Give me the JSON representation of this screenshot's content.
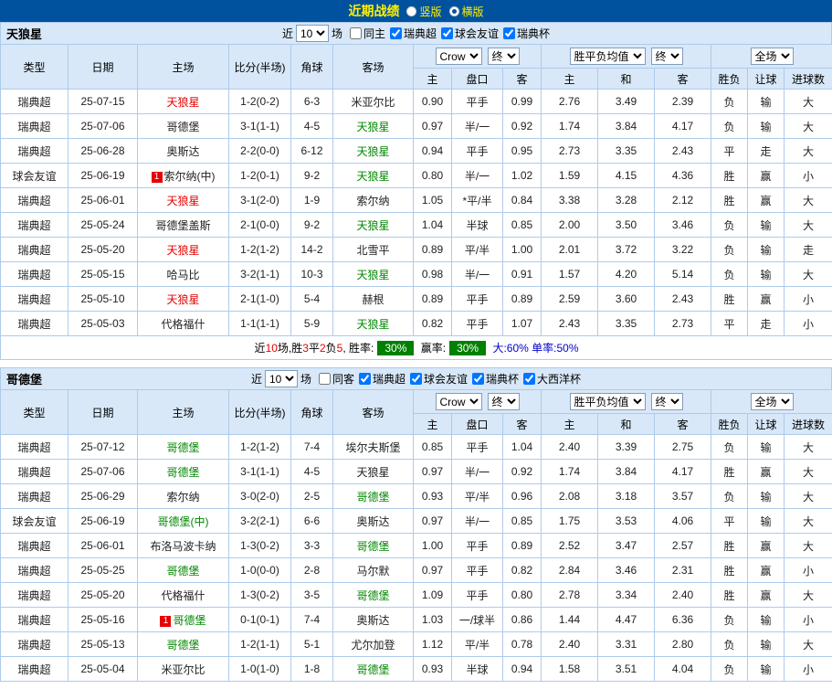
{
  "topbar": {
    "title": "近期战绩",
    "options": [
      {
        "label": "竖版",
        "selected": false
      },
      {
        "label": "横版",
        "selected": true
      }
    ]
  },
  "colors": {
    "accent": "#00529E",
    "friendly": "#00A098",
    "win": "#E60000",
    "draw": "#0000CC",
    "lose": "#008800",
    "rate_badge_bg": "#008000",
    "header_bg": "#D8E8F8"
  },
  "sections": [
    {
      "team": "天狼星",
      "filter": {
        "near": "近",
        "count": "10",
        "unit": "场",
        "checkboxes": [
          {
            "label": "同主",
            "checked": false
          },
          {
            "label": "瑞典超",
            "checked": true
          },
          {
            "label": "球会友谊",
            "checked": true
          },
          {
            "label": "瑞典杯",
            "checked": true
          }
        ]
      },
      "header": {
        "type": "类型",
        "date": "日期",
        "home": "主场",
        "score": "比分(半场)",
        "corner": "角球",
        "away": "客场",
        "odds_company": "Crow",
        "odds_stage": "终",
        "avg_label": "胜平负均值",
        "avg_stage": "终",
        "scope_label": "全场",
        "sub": [
          "主",
          "盘口",
          "客",
          "主",
          "和",
          "客",
          "胜负",
          "让球",
          "进球数"
        ]
      },
      "rows": [
        {
          "league": "瑞典超",
          "league_type": "league",
          "date": "25-07-15",
          "home": "天狼星",
          "home_color": "red",
          "home_badge": "",
          "score": "1-2(0-2)",
          "corner": "6-3",
          "away": "米亚尔比",
          "away_color": "black",
          "odds_home": "0.90",
          "handicap": "平手",
          "odds_away": "0.99",
          "avg_home": "2.76",
          "avg_draw": "3.49",
          "avg_away": "2.39",
          "result": "负",
          "result_color": "green",
          "cover": "输",
          "cover_color": "green",
          "goals": "大",
          "goals_color": "red"
        },
        {
          "league": "瑞典超",
          "league_type": "league",
          "date": "25-07-06",
          "home": "哥德堡",
          "home_color": "black",
          "home_badge": "",
          "score": "3-1(1-1)",
          "corner": "4-5",
          "away": "天狼星",
          "away_color": "green",
          "odds_home": "0.97",
          "handicap": "半/一",
          "odds_away": "0.92",
          "avg_home": "1.74",
          "avg_draw": "3.84",
          "avg_away": "4.17",
          "result": "负",
          "result_color": "green",
          "cover": "输",
          "cover_color": "green",
          "goals": "大",
          "goals_color": "red"
        },
        {
          "league": "瑞典超",
          "league_type": "league",
          "date": "25-06-28",
          "home": "奥斯达",
          "home_color": "black",
          "home_badge": "",
          "score": "2-2(0-0)",
          "corner": "6-12",
          "away": "天狼星",
          "away_color": "green",
          "odds_home": "0.94",
          "handicap": "平手",
          "odds_away": "0.95",
          "avg_home": "2.73",
          "avg_draw": "3.35",
          "avg_away": "2.43",
          "result": "平",
          "result_color": "blue",
          "cover": "走",
          "cover_color": "blue",
          "goals": "大",
          "goals_color": "red"
        },
        {
          "league": "球会友谊",
          "league_type": "friendly",
          "date": "25-06-19",
          "home": "索尔纳(中)",
          "home_color": "black",
          "home_badge": "1",
          "score": "1-2(0-1)",
          "corner": "9-2",
          "away": "天狼星",
          "away_color": "green",
          "odds_home": "0.80",
          "handicap": "半/一",
          "odds_away": "1.02",
          "avg_home": "1.59",
          "avg_draw": "4.15",
          "avg_away": "4.36",
          "result": "胜",
          "result_color": "red",
          "cover": "赢",
          "cover_color": "red",
          "goals": "小",
          "goals_color": "green"
        },
        {
          "league": "瑞典超",
          "league_type": "league",
          "date": "25-06-01",
          "home": "天狼星",
          "home_color": "red",
          "home_badge": "",
          "score": "3-1(2-0)",
          "corner": "1-9",
          "away": "索尔纳",
          "away_color": "black",
          "odds_home": "1.05",
          "handicap": "*平/半",
          "odds_away": "0.84",
          "avg_home": "3.38",
          "avg_draw": "3.28",
          "avg_away": "2.12",
          "result": "胜",
          "result_color": "red",
          "cover": "赢",
          "cover_color": "red",
          "goals": "大",
          "goals_color": "red"
        },
        {
          "league": "瑞典超",
          "league_type": "league",
          "date": "25-05-24",
          "home": "哥德堡盖斯",
          "home_color": "black",
          "home_badge": "",
          "score": "2-1(0-0)",
          "corner": "9-2",
          "away": "天狼星",
          "away_color": "green",
          "odds_home": "1.04",
          "handicap": "半球",
          "odds_away": "0.85",
          "avg_home": "2.00",
          "avg_draw": "3.50",
          "avg_away": "3.46",
          "result": "负",
          "result_color": "green",
          "cover": "输",
          "cover_color": "green",
          "goals": "大",
          "goals_color": "red"
        },
        {
          "league": "瑞典超",
          "league_type": "league",
          "date": "25-05-20",
          "home": "天狼星",
          "home_color": "red",
          "home_badge": "",
          "score": "1-2(1-2)",
          "corner": "14-2",
          "away": "北雪平",
          "away_color": "black",
          "odds_home": "0.89",
          "handicap": "平/半",
          "odds_away": "1.00",
          "avg_home": "2.01",
          "avg_draw": "3.72",
          "avg_away": "3.22",
          "result": "负",
          "result_color": "green",
          "cover": "输",
          "cover_color": "green",
          "goals": "走",
          "goals_color": "blue"
        },
        {
          "league": "瑞典超",
          "league_type": "league",
          "date": "25-05-15",
          "home": "哈马比",
          "home_color": "black",
          "home_badge": "",
          "score": "3-2(1-1)",
          "corner": "10-3",
          "away": "天狼星",
          "away_color": "green",
          "odds_home": "0.98",
          "handicap": "半/一",
          "odds_away": "0.91",
          "avg_home": "1.57",
          "avg_draw": "4.20",
          "avg_away": "5.14",
          "result": "负",
          "result_color": "green",
          "cover": "输",
          "cover_color": "green",
          "goals": "大",
          "goals_color": "red"
        },
        {
          "league": "瑞典超",
          "league_type": "league",
          "date": "25-05-10",
          "home": "天狼星",
          "home_color": "red",
          "home_badge": "",
          "score": "2-1(1-0)",
          "corner": "5-4",
          "away": "赫根",
          "away_color": "black",
          "odds_home": "0.89",
          "handicap": "平手",
          "odds_away": "0.89",
          "avg_home": "2.59",
          "avg_draw": "3.60",
          "avg_away": "2.43",
          "result": "胜",
          "result_color": "red",
          "cover": "赢",
          "cover_color": "red",
          "goals": "小",
          "goals_color": "green"
        },
        {
          "league": "瑞典超",
          "league_type": "league",
          "date": "25-05-03",
          "home": "代格福什",
          "home_color": "black",
          "home_badge": "",
          "score": "1-1(1-1)",
          "corner": "5-9",
          "away": "天狼星",
          "away_color": "green",
          "odds_home": "0.82",
          "handicap": "平手",
          "odds_away": "1.07",
          "avg_home": "2.43",
          "avg_draw": "3.35",
          "avg_away": "2.73",
          "result": "平",
          "result_color": "blue",
          "cover": "走",
          "cover_color": "blue",
          "goals": "小",
          "goals_color": "green"
        }
      ],
      "summary": [
        {
          "text": "近",
          "color": "black"
        },
        {
          "text": "10",
          "color": "red"
        },
        {
          "text": "场,胜",
          "color": "black"
        },
        {
          "text": "3",
          "color": "red"
        },
        {
          "text": "平",
          "color": "black"
        },
        {
          "text": "2",
          "color": "red"
        },
        {
          "text": "负",
          "color": "black"
        },
        {
          "text": "5",
          "color": "red"
        },
        {
          "text": ", 胜率:",
          "color": "black"
        },
        {
          "text": "30%",
          "badge": true
        },
        {
          "text": " 赢率:",
          "color": "black"
        },
        {
          "text": "30%",
          "badge": true
        },
        {
          "text": " 大:60%",
          "color": "blue"
        },
        {
          "text": " 单率:50%",
          "color": "blue"
        }
      ]
    },
    {
      "team": "哥德堡",
      "filter": {
        "near": "近",
        "count": "10",
        "unit": "场",
        "checkboxes": [
          {
            "label": "同客",
            "checked": false
          },
          {
            "label": "瑞典超",
            "checked": true
          },
          {
            "label": "球会友谊",
            "checked": true
          },
          {
            "label": "瑞典杯",
            "checked": true
          },
          {
            "label": "大西洋杯",
            "checked": true
          }
        ]
      },
      "header": {
        "type": "类型",
        "date": "日期",
        "home": "主场",
        "score": "比分(半场)",
        "corner": "角球",
        "away": "客场",
        "odds_company": "Crow",
        "odds_stage": "终",
        "avg_label": "胜平负均值",
        "avg_stage": "终",
        "scope_label": "全场",
        "sub": [
          "主",
          "盘口",
          "客",
          "主",
          "和",
          "客",
          "胜负",
          "让球",
          "进球数"
        ]
      },
      "rows": [
        {
          "league": "瑞典超",
          "league_type": "league",
          "date": "25-07-12",
          "home": "哥德堡",
          "home_color": "green",
          "home_badge": "",
          "score": "1-2(1-2)",
          "corner": "7-4",
          "away": "埃尔夫斯堡",
          "away_color": "black",
          "odds_home": "0.85",
          "handicap": "平手",
          "odds_away": "1.04",
          "avg_home": "2.40",
          "avg_draw": "3.39",
          "avg_away": "2.75",
          "result": "负",
          "result_color": "green",
          "cover": "输",
          "cover_color": "green",
          "goals": "大",
          "goals_color": "red"
        },
        {
          "league": "瑞典超",
          "league_type": "league",
          "date": "25-07-06",
          "home": "哥德堡",
          "home_color": "green",
          "home_badge": "",
          "score": "3-1(1-1)",
          "corner": "4-5",
          "away": "天狼星",
          "away_color": "black",
          "odds_home": "0.97",
          "handicap": "半/一",
          "odds_away": "0.92",
          "avg_home": "1.74",
          "avg_draw": "3.84",
          "avg_away": "4.17",
          "result": "胜",
          "result_color": "red",
          "cover": "赢",
          "cover_color": "red",
          "goals": "大",
          "goals_color": "red"
        },
        {
          "league": "瑞典超",
          "league_type": "league",
          "date": "25-06-29",
          "home": "索尔纳",
          "home_color": "black",
          "home_badge": "",
          "score": "3-0(2-0)",
          "corner": "2-5",
          "away": "哥德堡",
          "away_color": "green",
          "odds_home": "0.93",
          "handicap": "平/半",
          "odds_away": "0.96",
          "avg_home": "2.08",
          "avg_draw": "3.18",
          "avg_away": "3.57",
          "result": "负",
          "result_color": "green",
          "cover": "输",
          "cover_color": "green",
          "goals": "大",
          "goals_color": "red"
        },
        {
          "league": "球会友谊",
          "league_type": "friendly",
          "date": "25-06-19",
          "home": "哥德堡(中)",
          "home_color": "green",
          "home_badge": "",
          "score": "3-2(2-1)",
          "corner": "6-6",
          "away": "奥斯达",
          "away_color": "black",
          "odds_home": "0.97",
          "handicap": "半/一",
          "odds_away": "0.85",
          "avg_home": "1.75",
          "avg_draw": "3.53",
          "avg_away": "4.06",
          "result": "平",
          "result_color": "blue",
          "cover": "输",
          "cover_color": "green",
          "goals": "大",
          "goals_color": "red"
        },
        {
          "league": "瑞典超",
          "league_type": "league",
          "date": "25-06-01",
          "home": "布洛马波卡纳",
          "home_color": "black",
          "home_badge": "",
          "score": "1-3(0-2)",
          "corner": "3-3",
          "away": "哥德堡",
          "away_color": "green",
          "odds_home": "1.00",
          "handicap": "平手",
          "odds_away": "0.89",
          "avg_home": "2.52",
          "avg_draw": "3.47",
          "avg_away": "2.57",
          "result": "胜",
          "result_color": "red",
          "cover": "赢",
          "cover_color": "red",
          "goals": "大",
          "goals_color": "red"
        },
        {
          "league": "瑞典超",
          "league_type": "league",
          "date": "25-05-25",
          "home": "哥德堡",
          "home_color": "green",
          "home_badge": "",
          "score": "1-0(0-0)",
          "corner": "2-8",
          "away": "马尔默",
          "away_color": "black",
          "odds_home": "0.97",
          "handicap": "平手",
          "odds_away": "0.82",
          "avg_home": "2.84",
          "avg_draw": "3.46",
          "avg_away": "2.31",
          "result": "胜",
          "result_color": "red",
          "cover": "赢",
          "cover_color": "red",
          "goals": "小",
          "goals_color": "green"
        },
        {
          "league": "瑞典超",
          "league_type": "league",
          "date": "25-05-20",
          "home": "代格福什",
          "home_color": "black",
          "home_badge": "",
          "score": "1-3(0-2)",
          "corner": "3-5",
          "away": "哥德堡",
          "away_color": "green",
          "odds_home": "1.09",
          "handicap": "平手",
          "odds_away": "0.80",
          "avg_home": "2.78",
          "avg_draw": "3.34",
          "avg_away": "2.40",
          "result": "胜",
          "result_color": "red",
          "cover": "赢",
          "cover_color": "red",
          "goals": "大",
          "goals_color": "red"
        },
        {
          "league": "瑞典超",
          "league_type": "league",
          "date": "25-05-16",
          "home": "哥德堡",
          "home_color": "green",
          "home_badge": "1",
          "score": "0-1(0-1)",
          "corner": "7-4",
          "away": "奥斯达",
          "away_color": "black",
          "odds_home": "1.03",
          "handicap": "一/球半",
          "odds_away": "0.86",
          "avg_home": "1.44",
          "avg_draw": "4.47",
          "avg_away": "6.36",
          "result": "负",
          "result_color": "green",
          "cover": "输",
          "cover_color": "green",
          "goals": "小",
          "goals_color": "green"
        },
        {
          "league": "瑞典超",
          "league_type": "league",
          "date": "25-05-13",
          "home": "哥德堡",
          "home_color": "green",
          "home_badge": "",
          "score": "1-2(1-1)",
          "corner": "5-1",
          "away": "尤尔加登",
          "away_color": "black",
          "odds_home": "1.12",
          "handicap": "平/半",
          "odds_away": "0.78",
          "avg_home": "2.40",
          "avg_draw": "3.31",
          "avg_away": "2.80",
          "result": "负",
          "result_color": "green",
          "cover": "输",
          "cover_color": "green",
          "goals": "大",
          "goals_color": "red"
        },
        {
          "league": "瑞典超",
          "league_type": "league",
          "date": "25-05-04",
          "home": "米亚尔比",
          "home_color": "black",
          "home_badge": "",
          "score": "1-0(1-0)",
          "corner": "1-8",
          "away": "哥德堡",
          "away_color": "green",
          "odds_home": "0.93",
          "handicap": "半球",
          "odds_away": "0.94",
          "avg_home": "1.58",
          "avg_draw": "3.51",
          "avg_away": "4.04",
          "result": "负",
          "result_color": "green",
          "cover": "输",
          "cover_color": "green",
          "goals": "小",
          "goals_color": "green"
        }
      ],
      "summary": []
    }
  ]
}
